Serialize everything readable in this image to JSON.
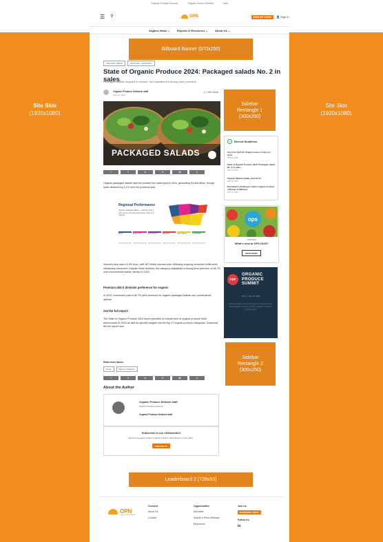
{
  "skins": {
    "left": [
      "Site Skin",
      "(1920x1080)"
    ],
    "right": [
      "Site Skin",
      "(1920x1080)"
    ]
  },
  "topbar": [
    "Organic Produce Summit",
    "Organic Grower Summit",
    "Jobs"
  ],
  "header": {
    "logo": "OPN",
    "subscribe": "SIGN UP TODAY",
    "signin": "Sign In"
  },
  "nav": [
    "Organic News ⌄",
    "Reports & Resources ⌄",
    "About Us ⌄"
  ],
  "billboard": "Billboard Banner (970x250)",
  "article": {
    "tags": [
      "ORGANIC NEWS",
      "GROCERY SHOPPING"
    ],
    "title": "State of Organic Produce 2024: Packaged salads No. 2 in sales",
    "subtitle": "Packaged salads dropped in volume, but maintained a strong price premium.",
    "author": "Organic Produce Network staff",
    "date": "April 24, 2024",
    "readtime": "1 Min Read",
    "hero_caption": "PACKAGED SALADS",
    "share": [
      "f",
      "𝕏",
      "in",
      "✉",
      "▤",
      "⎙"
    ],
    "para1": "Organic packaged salads held the number two sales spot in 2024, generating $1.6M billion, though sales declined by 5.1% from the previous year.",
    "region_title": "Regional Performance",
    "region_text": "Organic packaged salads — sales by region with volume and price data across major U.S. markets.",
    "region_cols": [
      "WEST",
      "MIDSOUTH",
      "NORTHEAST",
      "MIDWEST",
      "SOUTHEAST",
      "CALIFORNIA"
    ],
    "para2": "Volumes also saw a 6.5% drop, with 187 million pounds sold, reflecting ongoing consumer shifts amid inflationary pressures. Despite these declines, the category maintained a strong price premium of 68.7% over conventional salads, similar to 2023.",
    "h_premium": "Premium didn't diminish preference for organic",
    "para3": "In 2024, consumers paid a 68.7% price premium for organic packaged salads over conventional options.",
    "h_report": "Get the full report:",
    "para4": "The State of Organic Produce 2024 report provides an overall view of organic produce retail performance in 2024 as well as specific insights into the top 27 organic produce categories. Download the full report here.",
    "read_more": "Read more about:",
    "read_tags": [
      "News",
      "State of Organics"
    ]
  },
  "about": {
    "title": "About the Author",
    "name": "Organic Produce Network staff",
    "org": "Organic Produce Network",
    "name2": "Organic Produce Network staff"
  },
  "newsletter": {
    "title": "Subscribe to our eNewsletter!",
    "text": "Receive the latest organic produce industry news directly in your inbox.",
    "button": "SIGN ME UP"
  },
  "sidebar": {
    "ad1": [
      "Sidebar",
      "Rectangle 1",
      "(300x250)"
    ],
    "headlines_title": "Recent Headlines",
    "headlines": [
      {
        "title": "Top 5 for April 24: Organic news to help you grow",
        "date": "APR 24, 2025"
      },
      {
        "title": "State of Organic Produce 2024: Packaged salads No. 2 in sales",
        "date": "APR 24, 2025"
      },
      {
        "title": "Organic Market Update April 21-27",
        "date": "APR 23, 2025"
      },
      {
        "title": "Distribution challenges reduce organic produce offerings in Midwest",
        "date": "APR 23, 2025"
      }
    ],
    "ops_label": "OPS 2025",
    "ops_q": "What's new at OPS 2025?",
    "ops_btn": "READ MORE",
    "ops_mark": "ops",
    "summit_mark": "ops",
    "summit_title": [
      "ORGANIC",
      "PRODUCE",
      "SUMMIT"
    ],
    "summit_date": "JUL 9 – JUL 10, 2025",
    "summit_text": "Discover what's new at the Organic Produce Summit, where organic retailers, growers, shippers and more come together.",
    "ad2": [
      "Sidebar",
      "Rectangle 2",
      "(300x250)"
    ]
  },
  "leaderboard": "Leaderboard 2 (728x90)",
  "footer": {
    "logo": "OPN",
    "logo_sub": "Organic Produce Network",
    "connect": {
      "h": "Connect",
      "links": [
        "About Us",
        "Contact"
      ]
    },
    "opps": {
      "h": "Opportunities",
      "links": [
        "Advertise",
        "Submit a Press Release",
        "Resources"
      ]
    },
    "join": {
      "h": "Join Us",
      "button": "SUBSCRIBE TODAY",
      "follow": "Follow Us",
      "social": "in"
    }
  }
}
